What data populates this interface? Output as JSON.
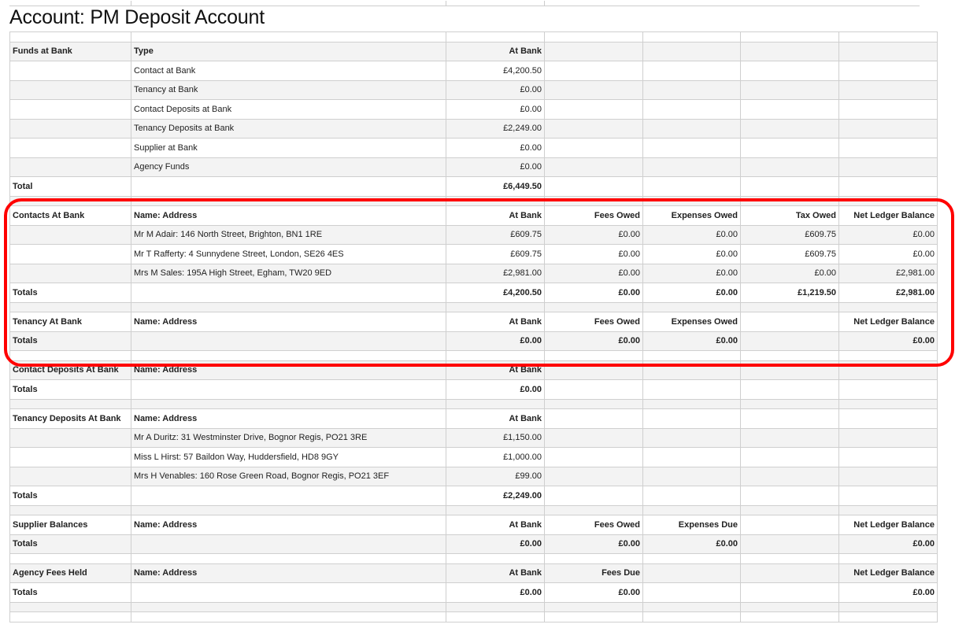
{
  "title": "Account: PM Deposit Account",
  "highlight_color": "#ff0000",
  "rows": [
    {
      "spacer": true
    },
    {
      "bold": true,
      "cells": [
        "Funds at Bank",
        "Type",
        "At Bank",
        "",
        "",
        "",
        ""
      ]
    },
    {
      "cells": [
        "",
        "Contact at Bank",
        "£4,200.50",
        "",
        "",
        "",
        ""
      ]
    },
    {
      "cells": [
        "",
        "Tenancy at Bank",
        "£0.00",
        "",
        "",
        "",
        ""
      ]
    },
    {
      "cells": [
        "",
        "Contact Deposits at Bank",
        "£0.00",
        "",
        "",
        "",
        ""
      ]
    },
    {
      "cells": [
        "",
        "Tenancy Deposits at Bank",
        "£2,249.00",
        "",
        "",
        "",
        ""
      ]
    },
    {
      "cells": [
        "",
        "Supplier at Bank",
        "£0.00",
        "",
        "",
        "",
        ""
      ]
    },
    {
      "cells": [
        "",
        "Agency Funds",
        "£0.00",
        "",
        "",
        "",
        ""
      ]
    },
    {
      "boldfirst": true,
      "cells": [
        "Total",
        "",
        "£6,449.50",
        "",
        "",
        "",
        ""
      ]
    },
    {
      "spacer": true
    },
    {
      "bold": true,
      "cells": [
        "Contacts At Bank",
        "Name: Address",
        "At Bank",
        "Fees Owed",
        "Expenses Owed",
        "Tax Owed",
        "Net Ledger Balance"
      ]
    },
    {
      "cells": [
        "",
        "Mr M Adair: 146 North Street, Brighton, BN1 1RE",
        "£609.75",
        "£0.00",
        "£0.00",
        "£609.75",
        "£0.00"
      ]
    },
    {
      "cells": [
        "",
        "Mr T Rafferty: 4 Sunnydene Street, London, SE26 4ES",
        "£609.75",
        "£0.00",
        "£0.00",
        "£609.75",
        "£0.00"
      ]
    },
    {
      "cells": [
        "",
        "Mrs M Sales: 195A High Street, Egham, TW20 9ED",
        "£2,981.00",
        "£0.00",
        "£0.00",
        "£0.00",
        "£2,981.00"
      ]
    },
    {
      "bold": true,
      "cells": [
        "Totals",
        "",
        "£4,200.50",
        "£0.00",
        "£0.00",
        "£1,219.50",
        "£2,981.00"
      ]
    },
    {
      "spacer": true
    },
    {
      "bold": true,
      "cells": [
        "Tenancy At Bank",
        "Name: Address",
        "At Bank",
        "Fees Owed",
        "Expenses Owed",
        "",
        "Net Ledger Balance"
      ]
    },
    {
      "bold": true,
      "cells": [
        "Totals",
        "",
        "£0.00",
        "£0.00",
        "£0.00",
        "",
        "£0.00"
      ]
    },
    {
      "spacer": true
    },
    {
      "bold": true,
      "cells": [
        "Contact Deposits At Bank",
        "Name: Address",
        "At Bank",
        "",
        "",
        "",
        ""
      ]
    },
    {
      "bold": true,
      "cells": [
        "Totals",
        "",
        "£0.00",
        "",
        "",
        "",
        ""
      ]
    },
    {
      "spacer": true
    },
    {
      "bold": true,
      "cells": [
        "Tenancy Deposits At Bank",
        "Name: Address",
        "At Bank",
        "",
        "",
        "",
        ""
      ]
    },
    {
      "cells": [
        "",
        "Mr A Duritz: 31 Westminster Drive, Bognor Regis, PO21 3RE",
        "£1,150.00",
        "",
        "",
        "",
        ""
      ]
    },
    {
      "cells": [
        "",
        "Miss L Hirst: 57 Baildon Way, Huddersfield, HD8 9GY",
        "£1,000.00",
        "",
        "",
        "",
        ""
      ]
    },
    {
      "cells": [
        "",
        "Mrs H Venables: 160 Rose Green Road, Bognor Regis, PO21 3EF",
        "£99.00",
        "",
        "",
        "",
        ""
      ]
    },
    {
      "bold": true,
      "cells": [
        "Totals",
        "",
        "£2,249.00",
        "",
        "",
        "",
        ""
      ]
    },
    {
      "spacer": true
    },
    {
      "bold": true,
      "cells": [
        "Supplier Balances",
        "Name: Address",
        "At Bank",
        "Fees Owed",
        "Expenses Due",
        "",
        "Net Ledger Balance"
      ]
    },
    {
      "bold": true,
      "cells": [
        "Totals",
        "",
        "£0.00",
        "£0.00",
        "£0.00",
        "",
        "£0.00"
      ]
    },
    {
      "spacer": true
    },
    {
      "bold": true,
      "cells": [
        "Agency Fees Held",
        "Name: Address",
        "At Bank",
        "Fees Due",
        "",
        "",
        "Net Ledger Balance"
      ]
    },
    {
      "bold": true,
      "cells": [
        "Totals",
        "",
        "£0.00",
        "£0.00",
        "",
        "",
        "£0.00"
      ]
    },
    {
      "spacer": true
    },
    {
      "spacer": true
    }
  ]
}
